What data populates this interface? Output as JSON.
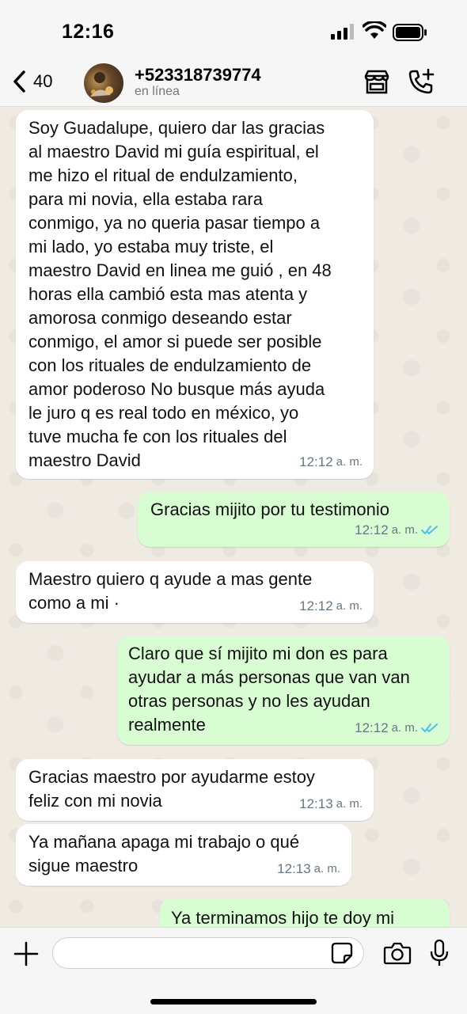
{
  "status_bar": {
    "time": "12:16"
  },
  "header": {
    "back_count": "40",
    "contact_name": "+523318739774",
    "contact_status": "en línea"
  },
  "messages": [
    {
      "direction": "in",
      "text": "Soy Guadalupe, quiero dar las gracias\nal maestro David mi guía espiritual, el\nme hizo el ritual de endulzamiento,\npara mi novia, ella estaba rara\nconmigo, ya no queria pasar tiempo a\nmi lado, yo estaba muy triste, el\nmaestro David en linea me guió , en 48\nhoras  ella cambió esta mas atenta y\namorosa conmigo deseando estar\nconmigo, el amor si puede ser posible\ncon los rituales de endulzamiento  de\namor poderoso No busque más ayuda\nle juro q es real todo en méxico, yo\ntuve mucha fe con los rituales del\nmaestro David",
      "time": "12:12",
      "ampm": "a. m."
    },
    {
      "direction": "out",
      "text": "Gracias mijito por tu testimonio",
      "time": "12:12",
      "ampm": "a. m."
    },
    {
      "direction": "in",
      "text": "Maestro quiero q ayude a mas gente\ncomo a mi ·",
      "time": "12:12",
      "ampm": "a. m."
    },
    {
      "direction": "out",
      "text": "Claro que sí mijito mi don es para\nayudar a más personas que van van\notras personas y no les ayudan\nrealmente",
      "time": "12:12",
      "ampm": "a. m."
    },
    {
      "direction": "in",
      "text": "Gracias maestro por ayudarme estoy\nfeliz con mi novia",
      "time": "12:13",
      "ampm": "a. m."
    },
    {
      "direction": "in",
      "text": "Ya mañana apaga mi trabajo o qué\nsigue maestro",
      "time": "12:13",
      "ampm": "a. m."
    },
    {
      "direction": "out",
      "text": "Ya terminamos hijo te doy mi",
      "time": "",
      "ampm": ""
    }
  ],
  "colors": {
    "incoming": "#ffffff",
    "outgoing": "#d9fdd3",
    "read_ticks": "#53bdeb"
  },
  "icons": [
    "back-chevron-icon",
    "store-icon",
    "add-call-icon",
    "plus-icon",
    "sticker-icon",
    "camera-icon",
    "mic-icon",
    "double-check-icon"
  ]
}
